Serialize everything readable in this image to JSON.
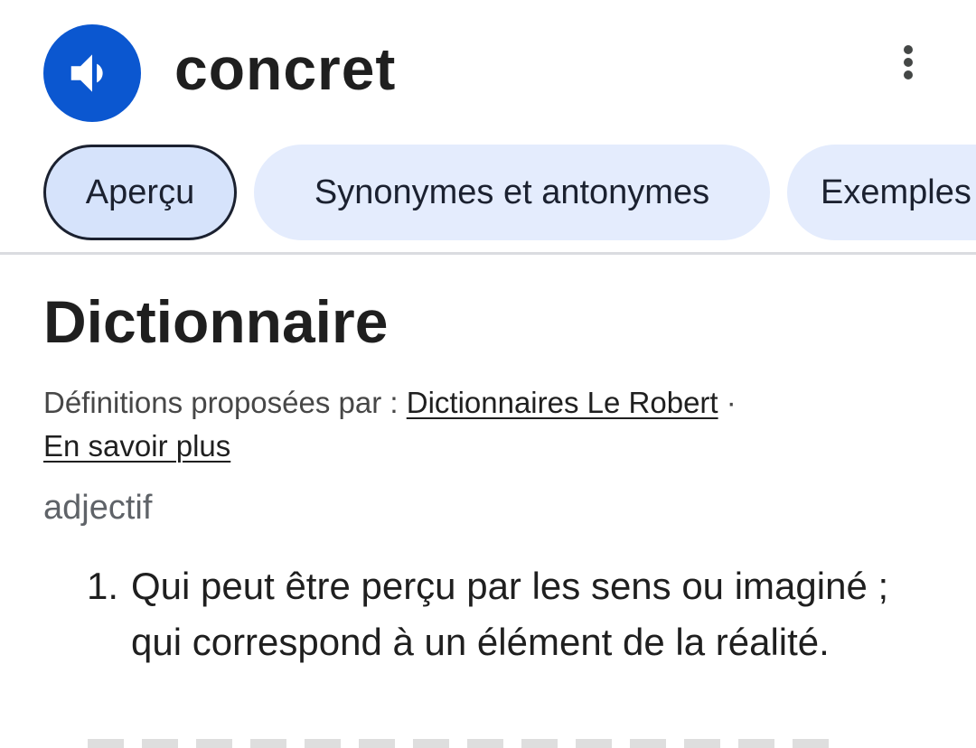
{
  "header": {
    "word": "concret",
    "speaker_icon": "volume-icon",
    "more_icon": "more-vert-icon",
    "accent_color": "#0b57d0"
  },
  "tabs": [
    {
      "label": "Aperçu",
      "selected": true
    },
    {
      "label": "Synonymes et antonymes",
      "selected": false
    },
    {
      "label": "Exemples",
      "selected": false
    }
  ],
  "dictionary": {
    "title": "Dictionnaire",
    "source_prefix": "Définitions proposées par : ",
    "source_link": "Dictionnaires Le Robert",
    "source_separator": " ·",
    "learn_more": "En savoir plus",
    "part_of_speech": "adjectif",
    "definitions": [
      {
        "number": "1.",
        "text": "Qui peut être perçu par les sens ou imaginé ; qui correspond à un élément de la réalité."
      }
    ]
  }
}
